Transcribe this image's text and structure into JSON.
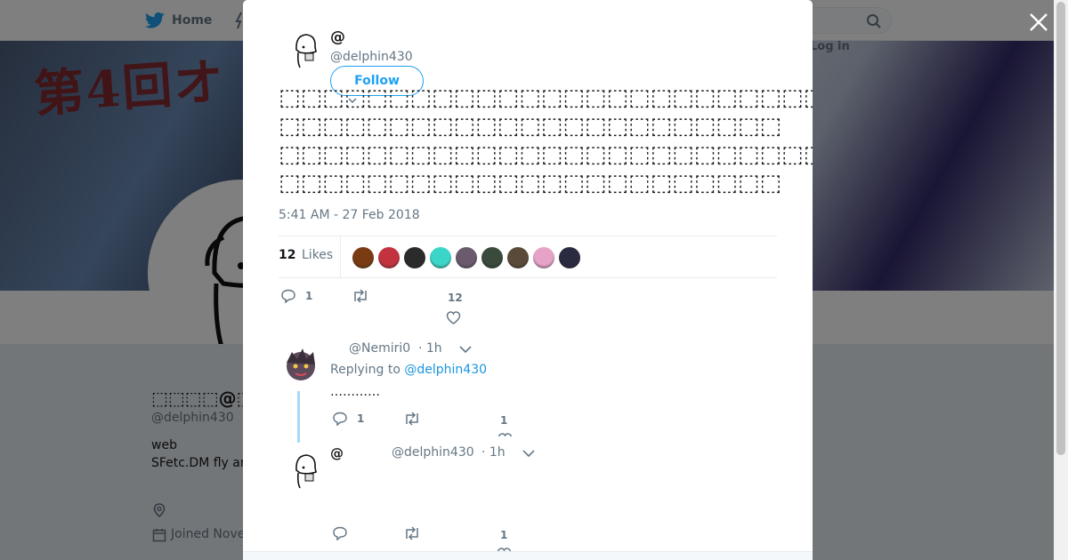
{
  "nav": {
    "home_label": "Home",
    "login_label": "Log in"
  },
  "banner": {
    "text": "第4回オ"
  },
  "profile": {
    "name": "⬚⬚⬚⬚@⬚⬚",
    "handle": "@delphin430",
    "bio_line1": "web",
    "bio_line2": "SFetc.DM fly an",
    "joined": "Joined Nove"
  },
  "tweet": {
    "name": "@",
    "handle": "@delphin430",
    "follow_label": "Follow",
    "text_lines": [
      "⬚⬚⬚⬚⬚⬚⬚⬚⬚⬚⬚⬚⬚⬚⬚⬚⬚⬚⬚⬚⬚⬚⬚⬚⬚⬚⬚⬚⬚⬚",
      "⬚⬚⬚⬚⬚⬚⬚⬚⬚⬚⬚⬚⬚⬚⬚⬚⬚⬚⬚⬚⬚⬚⬚",
      "⬚⬚⬚⬚⬚⬚⬚⬚⬚⬚⬚⬚⬚⬚⬚⬚⬚⬚⬚⬚⬚⬚⬚⬚⬚",
      "⬚⬚⬚⬚⬚⬚⬚⬚⬚⬚⬚⬚⬚⬚⬚⬚⬚⬚⬚⬚⬚⬚⬚"
    ],
    "timestamp": "5:41 AM - 27 Feb 2018",
    "likes_count": "12",
    "likes_label": "Likes",
    "reply_count": "1",
    "like_count": "12",
    "liker_colors": [
      "#7a3b12",
      "#c2333f",
      "#2b2b2b",
      "#3cd6c8",
      "#6b5a6e",
      "#3a4a3c",
      "#5a4a3a",
      "#e6a3c7",
      "#2a2a40"
    ]
  },
  "replies": [
    {
      "handle": "@Nemiri0",
      "time": "· 1h",
      "replying_prefix": "Replying to ",
      "replying_target": "@delphin430",
      "body": "…………",
      "reply_count": "1",
      "like_count": "1"
    },
    {
      "name": "@",
      "handle": "@delphin430",
      "time": "· 1h",
      "like_count": "1"
    }
  ]
}
